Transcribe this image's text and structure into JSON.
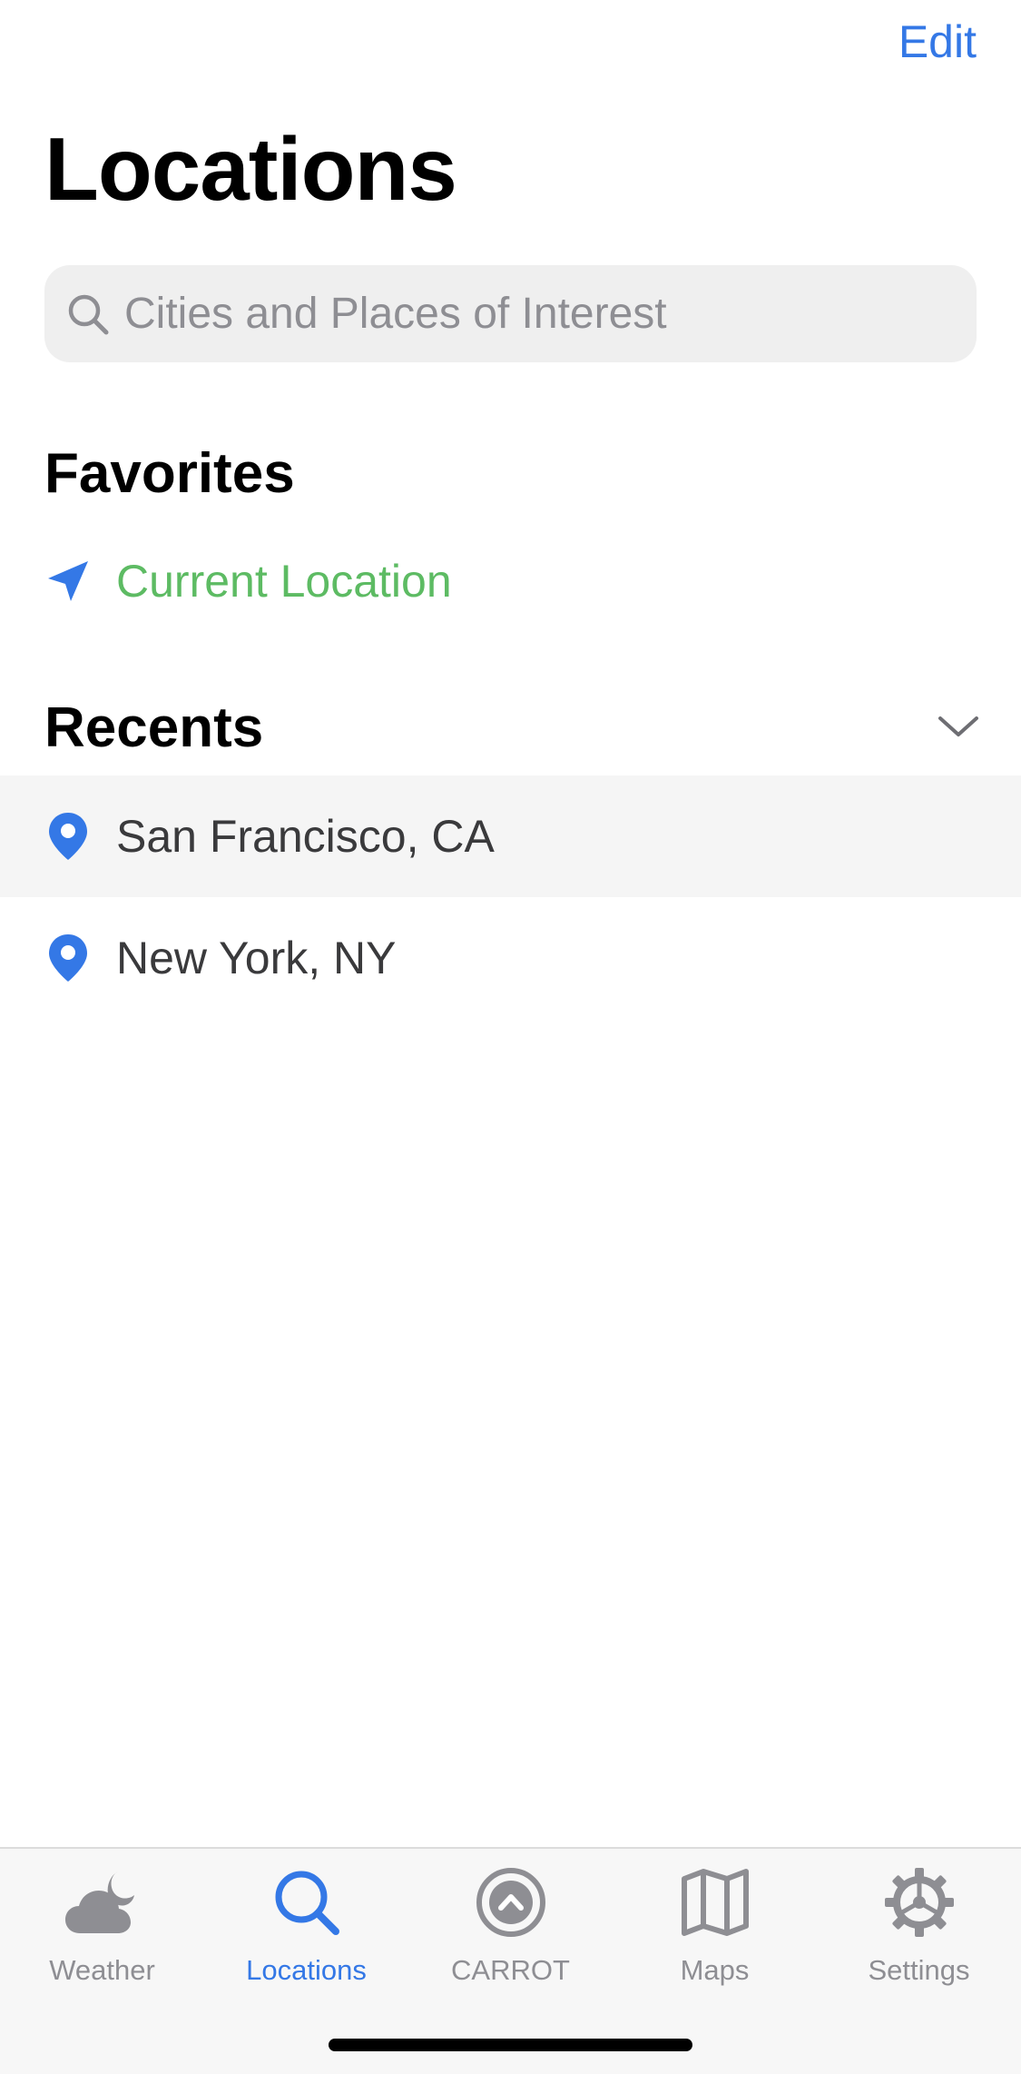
{
  "header": {
    "edit_label": "Edit",
    "title": "Locations"
  },
  "search": {
    "placeholder": "Cities and Places of Interest",
    "value": ""
  },
  "favorites": {
    "title": "Favorites",
    "items": [
      {
        "label": "Current Location",
        "icon": "location-arrow-icon"
      }
    ]
  },
  "recents": {
    "title": "Recents",
    "items": [
      {
        "label": "San Francisco, CA",
        "icon": "map-pin-icon"
      },
      {
        "label": "New York, NY",
        "icon": "map-pin-icon"
      }
    ]
  },
  "tabs": [
    {
      "label": "Weather",
      "icon": "cloud-moon-icon"
    },
    {
      "label": "Locations",
      "icon": "search-icon"
    },
    {
      "label": "CARROT",
      "icon": "carrot-logo-icon"
    },
    {
      "label": "Maps",
      "icon": "map-icon"
    },
    {
      "label": "Settings",
      "icon": "gear-icon"
    }
  ],
  "colors": {
    "accent": "#3478e6",
    "current_location": "#5dbb63",
    "pin": "#3478e6",
    "tab_inactive": "#8e8e93"
  }
}
